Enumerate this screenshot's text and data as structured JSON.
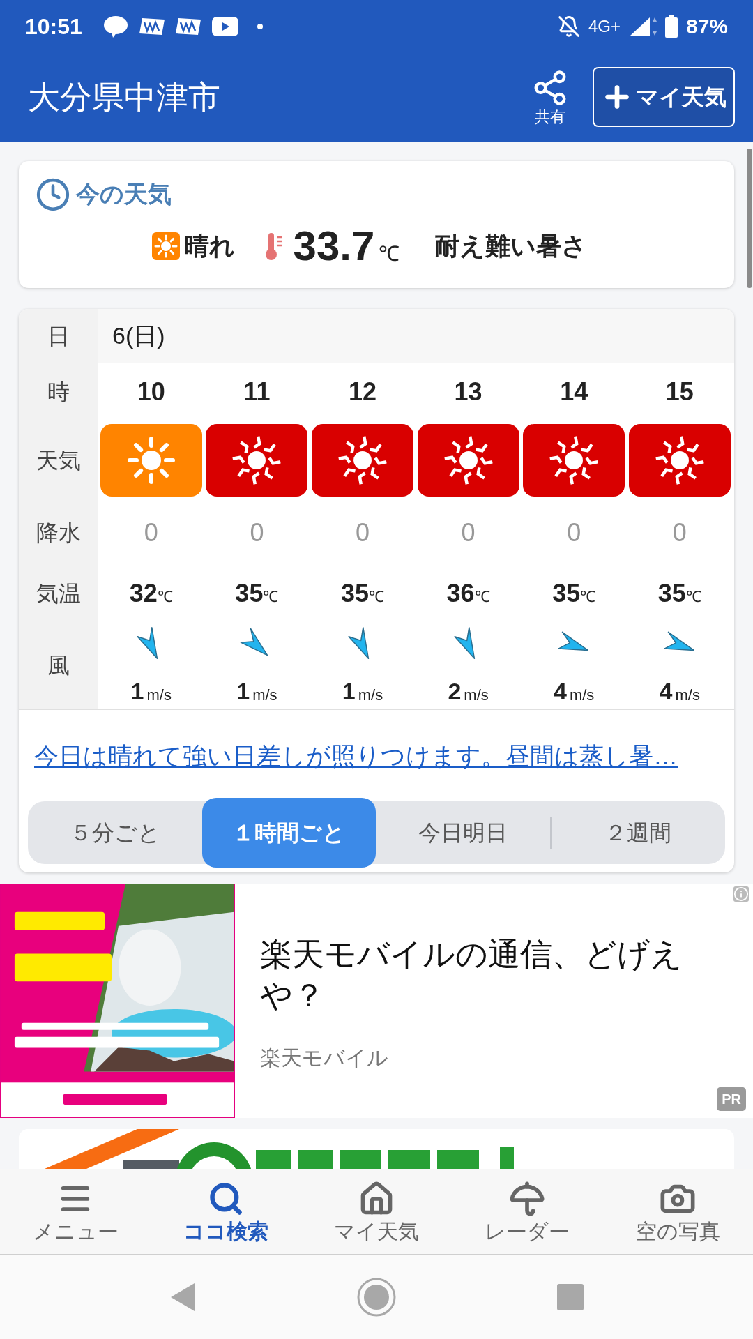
{
  "status_bar": {
    "time": "10:51",
    "network": "4G+",
    "battery": "87%"
  },
  "header": {
    "title": "大分県中津市",
    "share_label": "共有",
    "add_button": "マイ天気"
  },
  "current": {
    "heading": "今の天気",
    "condition": "晴れ",
    "temperature": "33.7",
    "unit": "℃",
    "comment": "耐え難い暑さ"
  },
  "hourly": {
    "labels": [
      "日",
      "時",
      "天気",
      "降水",
      "気温",
      "風"
    ],
    "date": "6(日)",
    "hours": [
      {
        "hour": "10",
        "kind": "sunny",
        "precip": "0",
        "temp": "32",
        "temp_unit": "℃",
        "wind": {
          "kind": "NNW"
        },
        "wind_speed": "1",
        "wind_unit": "m/s"
      },
      {
        "hour": "11",
        "kind": "extreme_heat",
        "precip": "0",
        "temp": "35",
        "temp_unit": "℃",
        "wind": {
          "kind": "NW"
        },
        "wind_speed": "1",
        "wind_unit": "m/s"
      },
      {
        "hour": "12",
        "kind": "extreme_heat",
        "precip": "0",
        "temp": "35",
        "temp_unit": "℃",
        "wind": {
          "kind": "NNW"
        },
        "wind_speed": "1",
        "wind_unit": "m/s"
      },
      {
        "hour": "13",
        "kind": "extreme_heat",
        "precip": "0",
        "temp": "36",
        "temp_unit": "℃",
        "wind": {
          "kind": "NNW"
        },
        "wind_speed": "2",
        "wind_unit": "m/s"
      },
      {
        "hour": "14",
        "kind": "extreme_heat",
        "precip": "0",
        "temp": "35",
        "temp_unit": "℃",
        "wind": {
          "kind": "WNW"
        },
        "wind_speed": "4",
        "wind_unit": "m/s"
      },
      {
        "hour": "15",
        "kind": "extreme_heat",
        "precip": "0",
        "temp": "35",
        "temp_unit": "℃",
        "wind": {
          "kind": "WNW"
        },
        "wind_speed": "4",
        "wind_unit": "m/s"
      }
    ]
  },
  "summary_link": "今日は晴れて強い日差しが照りつけます。昼間は蒸し暑…",
  "tabs": [
    {
      "label": "５分ごと",
      "selected": false
    },
    {
      "label": "１時間ごと",
      "selected": true
    },
    {
      "label": "今日明日",
      "selected": false
    },
    {
      "label": "２週間",
      "selected": false
    }
  ],
  "ad": {
    "title": "楽天モバイルの通信、どげえや？",
    "advertiser": "楽天モバイル",
    "badge": "PR"
  },
  "nav": [
    {
      "label": "メニュー",
      "selected": false
    },
    {
      "label": "ココ検索",
      "selected": true
    },
    {
      "label": "マイ天気",
      "selected": false
    },
    {
      "label": "レーダー",
      "selected": false
    },
    {
      "label": "空の写真",
      "selected": false
    }
  ]
}
